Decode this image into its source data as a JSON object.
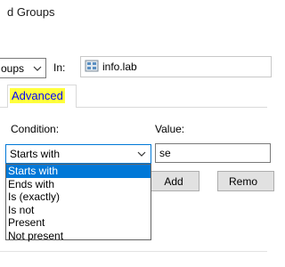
{
  "window": {
    "title_partial": "d Groups"
  },
  "find_row": {
    "type_value_partial": "oups",
    "in_label": "In:",
    "location": "info.lab"
  },
  "tabs": {
    "advanced_label": "Advanced"
  },
  "condition": {
    "label": "Condition:",
    "selected": "Starts with",
    "options": [
      "Starts with",
      "Ends with",
      "Is (exactly)",
      "Is not",
      "Present",
      "Not present"
    ],
    "highlighted_index": 0
  },
  "value": {
    "label": "Value:",
    "text": "se"
  },
  "buttons": {
    "add": "Add",
    "remove_partial": "Remo"
  },
  "colors": {
    "highlight": "#ffff3d",
    "selection": "#0078d7",
    "tab_text": "#0000ff"
  }
}
